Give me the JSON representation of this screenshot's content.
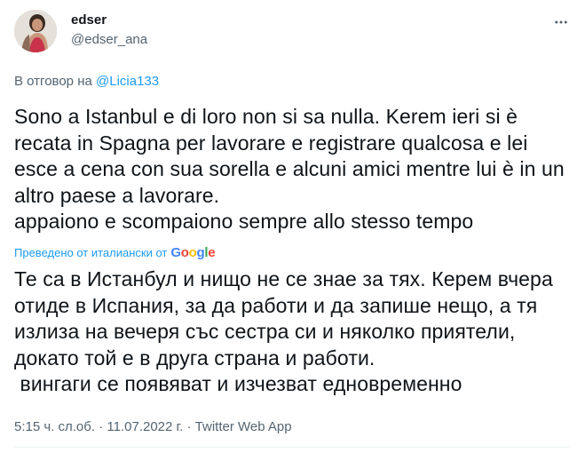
{
  "author": {
    "name": "edser",
    "handle": "@edser_ana",
    "avatar_icon": "profile-photo"
  },
  "more_icon": "more-dots-icon",
  "reply": {
    "prefix": "В отговор на ",
    "mention": "@Licia133"
  },
  "tweet": {
    "original": "Sono a Istanbul e di loro non si sa nulla. Kerem ieri si è recata in Spagna per lavorare e registrare qualcosa e lei esce a cena con sua sorella e alcuni amici mentre lui è in un altro paese a lavorare.\nappaiono e scompaiono sempre allo stesso tempo",
    "translated_by_label": "Преведено от италиански от",
    "translator_brand": [
      "G",
      "o",
      "o",
      "g",
      "l",
      "e"
    ],
    "translation": "Те са в Истанбул и нищо не се знае за тях. Керем вчера отиде в Испания, за да работи и да запише нещо, а тя излиза на вечеря със сестра си и няколко приятели, докато той е в друга страна и работи.\n вингаги се появяват и изчезват едновременно"
  },
  "meta": {
    "time": "5:15 ч. сл.об.",
    "sep1": " · ",
    "date": "11.07.2022 г.",
    "sep2": " · ",
    "source": "Twitter Web App"
  },
  "colors": {
    "text": "#0f1419",
    "secondary": "#536471",
    "link": "#1d9bf0"
  }
}
